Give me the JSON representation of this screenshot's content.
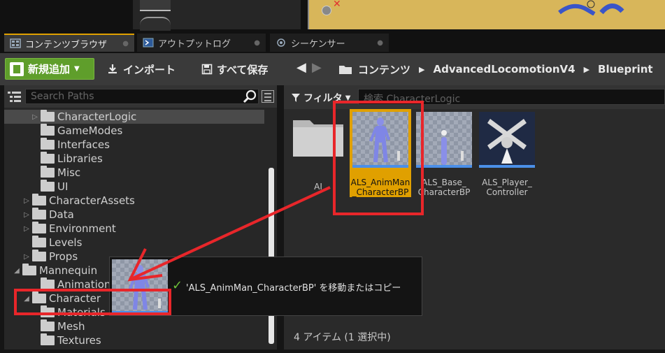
{
  "tabs": [
    {
      "label": "コンテンツブラウザ",
      "icon": "content-browser-icon",
      "active": true
    },
    {
      "label": "アウトプットログ",
      "icon": "output-log-icon",
      "active": false
    },
    {
      "label": "シーケンサー",
      "icon": "sequencer-icon",
      "active": false
    }
  ],
  "toolbar": {
    "add_new_label": "新規追加",
    "import_label": "インポート",
    "save_all_label": "すべて保存"
  },
  "breadcrumbs": [
    "コンテンツ",
    "AdvancedLocomotionV4",
    "Blueprint"
  ],
  "left_panel": {
    "search_placeholder": "Search Paths",
    "tree": [
      {
        "label": "CharacterLogic",
        "expandable": true,
        "selected": true
      },
      {
        "label": "GameModes"
      },
      {
        "label": "Interfaces"
      },
      {
        "label": "Libraries"
      },
      {
        "label": "Misc"
      },
      {
        "label": "UI"
      },
      {
        "label": "CharacterAssets",
        "expandable": true
      },
      {
        "label": "Data",
        "expandable": true
      },
      {
        "label": "Environment",
        "expandable": true
      },
      {
        "label": "Levels"
      },
      {
        "label": "Props",
        "expandable": true
      },
      {
        "label": "Mannequin",
        "expanded": true
      },
      {
        "label": "Animations"
      },
      {
        "label": "Character",
        "expanded": true
      },
      {
        "label": "Materials"
      },
      {
        "label": "Mesh"
      },
      {
        "label": "Textures"
      }
    ]
  },
  "right_panel": {
    "filter_label": "フィルタ",
    "search_placeholder": "検索 CharacterLogic",
    "assets": [
      {
        "label": "AI",
        "type": "folder"
      },
      {
        "label": "ALS_AnimMan_CharacterBP",
        "label_lines": [
          "ALS_AnimMan",
          "_CharacterBP"
        ],
        "selected": true
      },
      {
        "label": "ALS_Base_CharacterBP",
        "label_lines": [
          "ALS_Base_",
          "CharacterBP"
        ]
      },
      {
        "label": "ALS_Player_Controller",
        "label_lines": [
          "ALS_Player_",
          "Controller"
        ]
      }
    ],
    "status": "4 アイテム (1 選択中)"
  },
  "drag_tooltip": {
    "text": "'ALS_AnimMan_CharacterBP' を移動またはコピー"
  },
  "colors": {
    "accent": "#e0a000",
    "add_new_green": "#5f9e2b",
    "annotation_red": "#e8262a",
    "thumb_bar_blue": "#4b8fe8"
  }
}
